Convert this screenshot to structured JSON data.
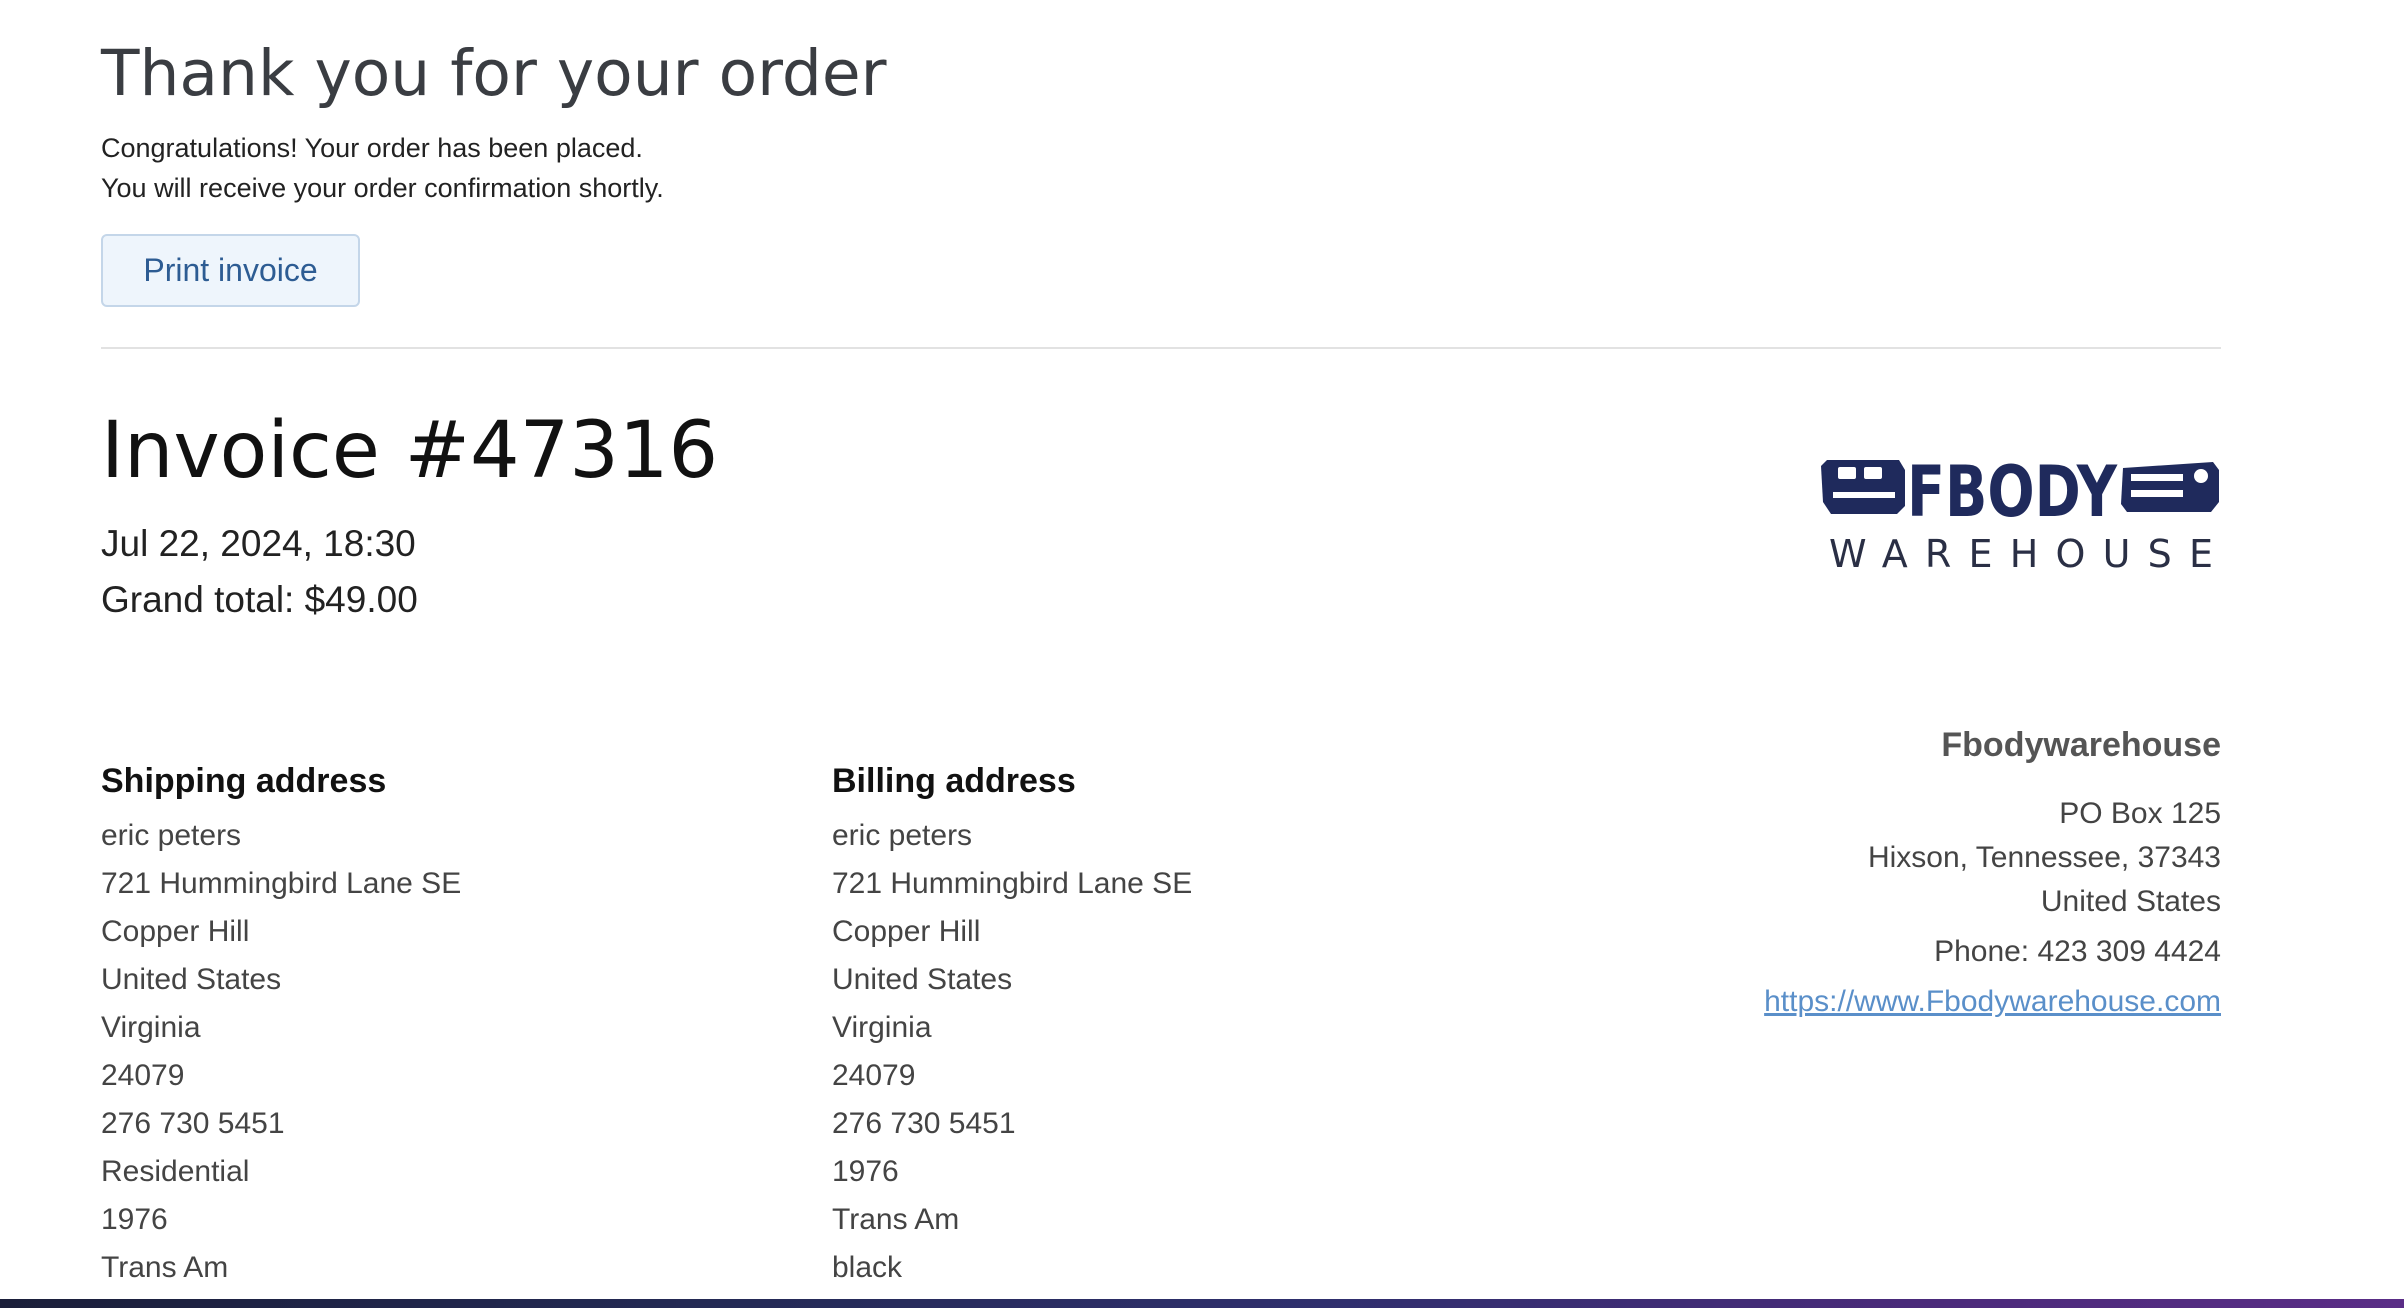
{
  "confirmation": {
    "heading": "Thank you for your order",
    "line1": "Congratulations! Your order has been placed.",
    "line2": "You will receive your order confirmation shortly.",
    "print_button": "Print invoice"
  },
  "invoice": {
    "title": "Invoice #47316",
    "date": "Jul 22, 2024, 18:30",
    "grand_total": "Grand total: $49.00"
  },
  "logo": {
    "brand_top": "FBODY",
    "brand_bottom": "WAREHOUSE",
    "brand_color": "#1f2a5c"
  },
  "shipping": {
    "title": "Shipping address",
    "lines": [
      "eric peters",
      "721 Hummingbird Lane SE",
      "Copper Hill",
      "United States",
      "Virginia",
      "24079",
      "276 730 5451",
      "Residential",
      "1976",
      "Trans Am"
    ]
  },
  "billing": {
    "title": "Billing address",
    "lines": [
      "eric peters",
      "721 Hummingbird Lane SE",
      "Copper Hill",
      "United States",
      "Virginia",
      "24079",
      "276 730 5451",
      "1976",
      "Trans Am",
      "black"
    ]
  },
  "store": {
    "name": "Fbodywarehouse",
    "address_lines": [
      "PO Box 125",
      "Hixson, Tennessee, 37343",
      "United States"
    ],
    "phone": "Phone: 423 309 4424",
    "website": "https://www.Fbodywarehouse.com",
    "link_color": "#5a8fc9"
  }
}
